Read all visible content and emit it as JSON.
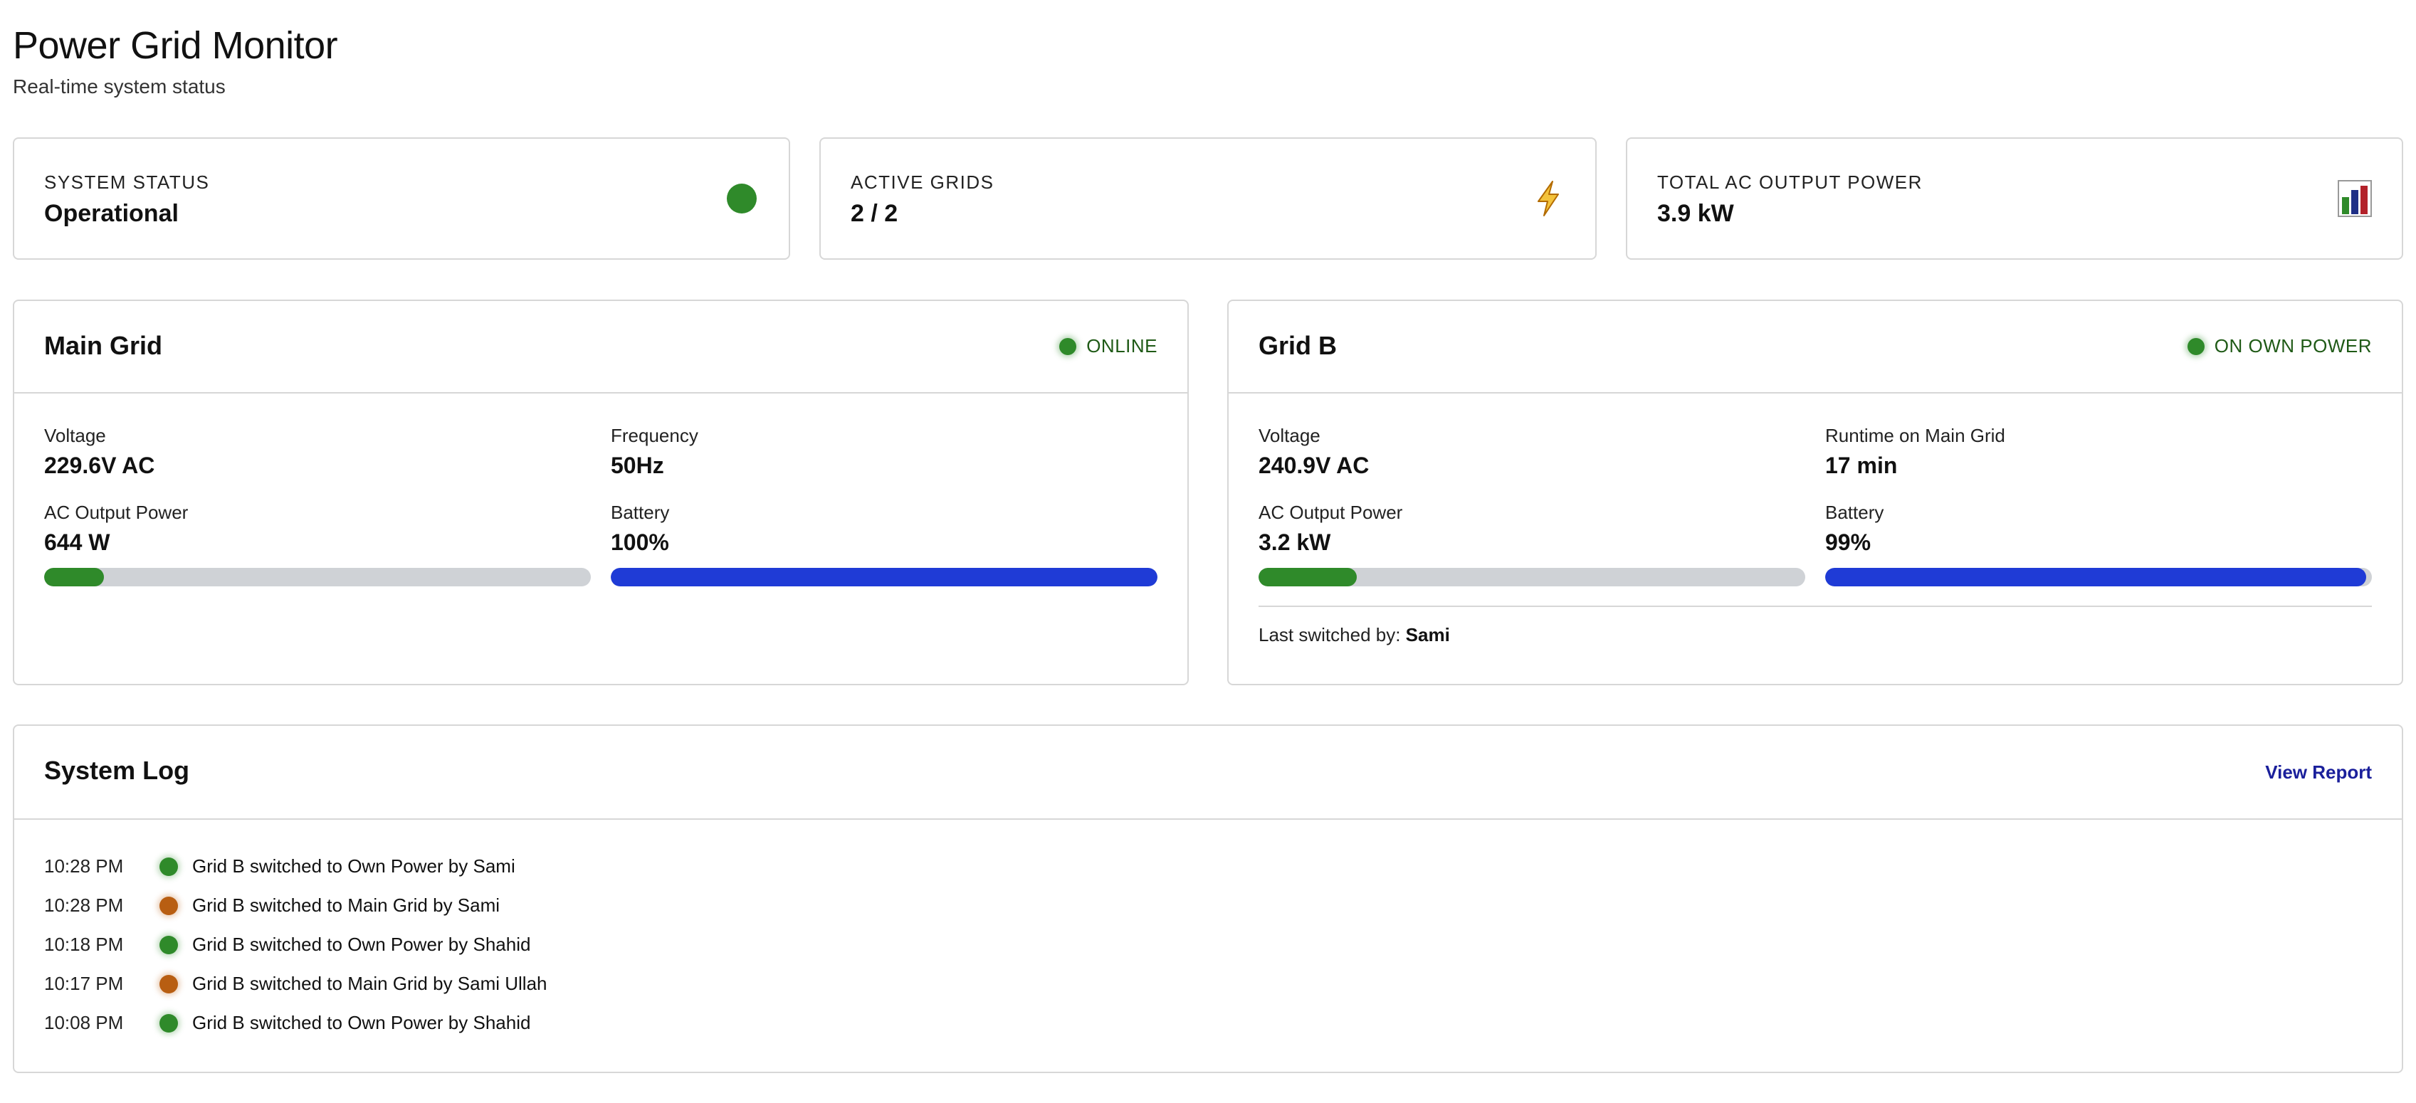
{
  "header": {
    "title": "Power Grid Monitor",
    "subtitle": "Real-time system status"
  },
  "stats": [
    {
      "label": "SYSTEM STATUS",
      "value": "Operational",
      "icon": "green-status-dot"
    },
    {
      "label": "ACTIVE GRIDS",
      "value": "2 / 2",
      "icon": "lightning-icon"
    },
    {
      "label": "TOTAL AC OUTPUT POWER",
      "value": "3.9 kW",
      "icon": "bar-chart-icon"
    }
  ],
  "grids": [
    {
      "title": "Main Grid",
      "status": "ONLINE",
      "metrics": [
        {
          "label": "Voltage",
          "value": "229.6V AC"
        },
        {
          "label": "Frequency",
          "value": "50Hz"
        },
        {
          "label": "AC Output Power",
          "value": "644 W",
          "bar_level": 0.11
        },
        {
          "label": "Battery",
          "value": "100%",
          "bar_level": 1.0
        }
      ]
    },
    {
      "title": "Grid B",
      "status": "ON OWN POWER",
      "metrics": [
        {
          "label": "Voltage",
          "value": "240.9V AC"
        },
        {
          "label": "Runtime on Main Grid",
          "value": "17 min"
        },
        {
          "label": "AC Output Power",
          "value": "3.2 kW",
          "bar_level": 0.18
        },
        {
          "label": "Battery",
          "value": "99%",
          "bar_level": 0.99
        }
      ],
      "last_switched_label": "Last switched by:",
      "last_switched_by": "Sami"
    }
  ],
  "log": {
    "title": "System Log",
    "view_report": "View Report",
    "entries": [
      {
        "time": "10:28 PM",
        "type": "own",
        "message": "Grid B switched to Own Power by Sami"
      },
      {
        "time": "10:28 PM",
        "type": "main",
        "message": "Grid B switched to Main Grid by Sami"
      },
      {
        "time": "10:18 PM",
        "type": "own",
        "message": "Grid B switched to Own Power by Shahid"
      },
      {
        "time": "10:17 PM",
        "type": "main",
        "message": "Grid B switched to Main Grid by Sami Ullah"
      },
      {
        "time": "10:08 PM",
        "type": "own",
        "message": "Grid B switched to Own Power by Shahid"
      }
    ]
  },
  "colors": {
    "online_green": "#2f8a2a",
    "main_grid_orange": "#b85e12",
    "battery_blue": "#1f3bd6",
    "link_blue": "#1a1f9b"
  }
}
